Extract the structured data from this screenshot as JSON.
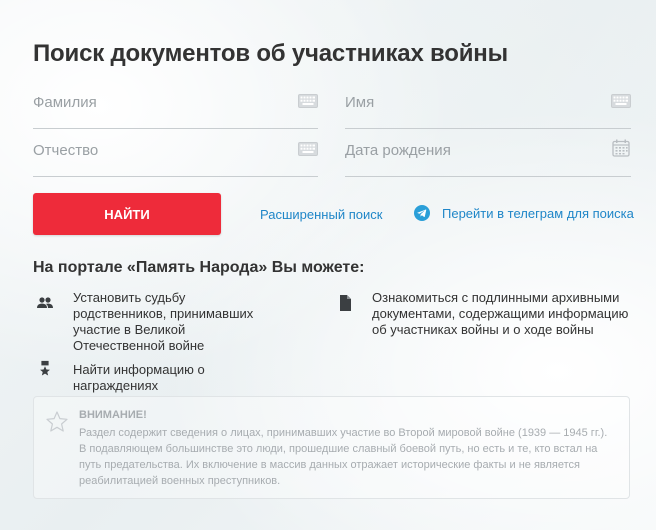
{
  "page_title": "Поиск документов об участниках войны",
  "form": {
    "last_name_placeholder": "Фамилия",
    "first_name_placeholder": "Имя",
    "middle_name_placeholder": "Отчество",
    "birth_date_placeholder": "Дата рождения",
    "search_button": "НАЙТИ",
    "advanced_search_link": "Расширенный поиск",
    "telegram_link": "Перейти в телеграм для поиска"
  },
  "features": {
    "heading": "На портале «Память Народа» Вы можете:",
    "items": [
      {
        "icon": "people-icon",
        "text": "Установить судьбу родственников, принимавших участие в Великой Отечественной войне"
      },
      {
        "icon": "document-icon",
        "text": "Ознакомиться с подлинными архивными документами, содержащими информацию об участниках войны и о ходе войны"
      },
      {
        "icon": "medal-icon",
        "text": "Найти информацию о награждениях"
      }
    ]
  },
  "notice": {
    "title": "ВНИМАНИЕ!",
    "body": "Раздел содержит сведения о лицах, принимавших участие во Второй мировой войне (1939 — 1945 гг.). В подавляющем большинстве это люди, прошедшие славный боевой путь, но есть и те, кто встал на путь предательства. Их включение в массив данных отражает исторические факты и не является реабилитацией военных преступников."
  },
  "colors": {
    "accent_red": "#ee2b3a",
    "link_blue": "#1f86c8",
    "text": "#333333",
    "muted": "#a7acb0"
  }
}
